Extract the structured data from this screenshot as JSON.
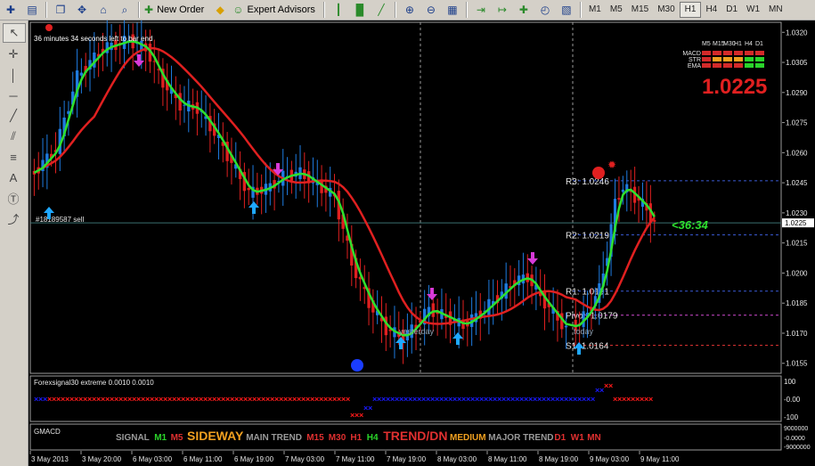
{
  "toolbar": {
    "new_order_label": "New Order",
    "expert_advisors_label": "Expert Advisors",
    "timeframes": [
      "M1",
      "M5",
      "M15",
      "M30",
      "H1",
      "H4",
      "D1",
      "W1",
      "MN"
    ],
    "active_timeframe": "H1"
  },
  "main_chart": {
    "bar_timer_text": "36 minutes 34 seconds left to bar end",
    "order_label": "#18189587 sell",
    "current_price": "1.0225",
    "big_price": "1.0225",
    "countdown": "<36:34",
    "price_ticks": [
      "1.0320",
      "1.0305",
      "1.0290",
      "1.0275",
      "1.0260",
      "1.0245",
      "1.0230",
      "1.0215",
      "1.0200",
      "1.0185",
      "1.0170",
      "1.0155"
    ],
    "pivots": [
      {
        "label": "R3: 1.0246",
        "price": 1.0246,
        "color": "#3b5bd6"
      },
      {
        "label": "R2: 1.0219",
        "price": 1.0219,
        "color": "#3b5bd6"
      },
      {
        "label": "R1: 1.0191",
        "price": 1.0191,
        "color": "#3b5bd6"
      },
      {
        "label": "Pivot: 1.0179",
        "price": 1.0179,
        "color": "#d14bd1"
      },
      {
        "label": "S1: 1.0164",
        "price": 1.0164,
        "color": "#d43030"
      }
    ],
    "yesterday_label": "yesterday",
    "today_label": "today"
  },
  "status_panel": {
    "timeframes": [
      "M5",
      "M15",
      "M30",
      "H1",
      "H4",
      "D1"
    ],
    "rows": [
      {
        "label": "MACD",
        "colors": [
          "#d42a2a",
          "#d42a2a",
          "#d42a2a",
          "#d42a2a",
          "#d42a2a",
          "#d42a2a"
        ]
      },
      {
        "label": "STR",
        "colors": [
          "#d42a2a",
          "#f0a020",
          "#f0a020",
          "#f0a020",
          "#2ad42a",
          "#2ad42a"
        ]
      },
      {
        "label": "EMA",
        "colors": [
          "#d42a2a",
          "#d42a2a",
          "#d42a2a",
          "#d42a2a",
          "#2ad42a",
          "#2ad42a"
        ]
      }
    ]
  },
  "indicator1": {
    "title": "Forexsignal30 extreme 0.0010 0.0010",
    "ticks": [
      "100",
      "-0.00",
      "-100"
    ]
  },
  "indicator2": {
    "title": "GMACD",
    "ticks": [
      "9000000",
      "-0.0000",
      "-9000000"
    ],
    "signal_parts": [
      {
        "text": "SIGNAL",
        "color": "#9a9a9a",
        "big": false
      },
      {
        "text": "M1",
        "color": "#2ad42a",
        "big": false
      },
      {
        "text": "M5",
        "color": "#e03030",
        "big": false
      },
      {
        "text": "SIDEWAY",
        "color": "#f0a020",
        "big": true
      },
      {
        "text": "MAIN TREND",
        "color": "#9a9a9a",
        "big": false
      },
      {
        "text": "M15",
        "color": "#e03030",
        "big": false
      },
      {
        "text": "M30",
        "color": "#e03030",
        "big": false
      },
      {
        "text": "H1",
        "color": "#e03030",
        "big": false
      },
      {
        "text": "H4",
        "color": "#2ad42a",
        "big": false
      },
      {
        "text": "TREND/DN",
        "color": "#e03030",
        "big": true
      },
      {
        "text": "MEDIUM",
        "color": "#f0a020",
        "big": false
      },
      {
        "text": "MAJOR TREND",
        "color": "#9a9a9a",
        "big": false
      },
      {
        "text": "D1",
        "color": "#e03030",
        "big": false
      },
      {
        "text": "W1",
        "color": "#e03030",
        "big": false
      },
      {
        "text": "MN",
        "color": "#e03030",
        "big": false
      }
    ]
  },
  "time_axis": [
    "3 May 2013",
    "3 May 20:00",
    "6 May 03:00",
    "6 May 11:00",
    "6 May 19:00",
    "7 May 03:00",
    "7 May 11:00",
    "7 May 19:00",
    "8 May 03:00",
    "8 May 11:00",
    "8 May 19:00",
    "9 May 03:00",
    "9 May 11:00"
  ],
  "colors": {
    "background": "#000000",
    "bull": "#1e7be0",
    "bear": "#e02020",
    "fast_ma": "#2ee02e",
    "slow_ma": "#e02020",
    "buy_arrow": "#1fa8ff",
    "sell_arrow": "#d83ad8",
    "signal_blue": "#1a1aff",
    "signal_red": "#ff1a1a"
  }
}
